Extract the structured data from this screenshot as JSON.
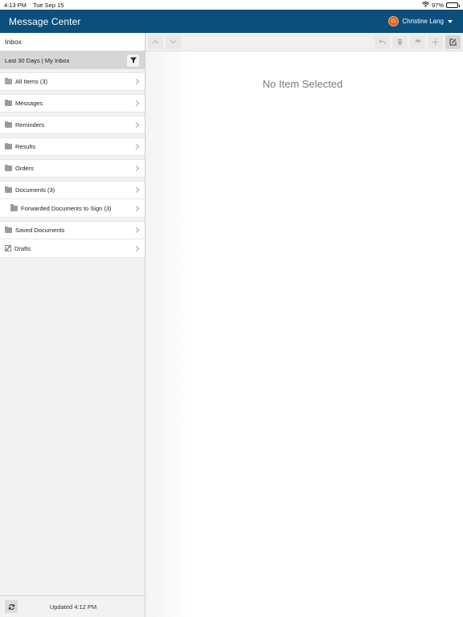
{
  "status_bar": {
    "time": "4:13 PM",
    "date": "Tue Sep 15",
    "battery": "97%",
    "battery_level": 0.97
  },
  "header": {
    "title": "Message Center",
    "user_initials": "CL",
    "user_name": "Christine Lang"
  },
  "sidebar": {
    "title": "Inbox",
    "filter_label": "Last 30 Days | My Inbox",
    "folders": [
      {
        "label": "All Items (3)",
        "icon": "folder-open-icon"
      },
      {
        "label": "Messages",
        "icon": "folder-icon"
      },
      {
        "label": "Reminders",
        "icon": "folder-icon"
      },
      {
        "label": "Results",
        "icon": "folder-icon"
      },
      {
        "label": "Orders",
        "icon": "folder-icon"
      },
      {
        "label": "Documents (3)",
        "icon": "folder-icon"
      },
      {
        "label": "Forwarded Documents to Sign (3)",
        "icon": "folder-icon"
      },
      {
        "label": "Saved Documents",
        "icon": "folder-icon"
      },
      {
        "label": "Drafts",
        "icon": "draft-icon"
      }
    ],
    "updated_text": "Updated 4:12 PM"
  },
  "main": {
    "empty_message": "No Item Selected"
  },
  "colors": {
    "header_bg": "#0b4f7d",
    "avatar": "#e8671f",
    "sidebar_bg": "#f2f2f2"
  }
}
